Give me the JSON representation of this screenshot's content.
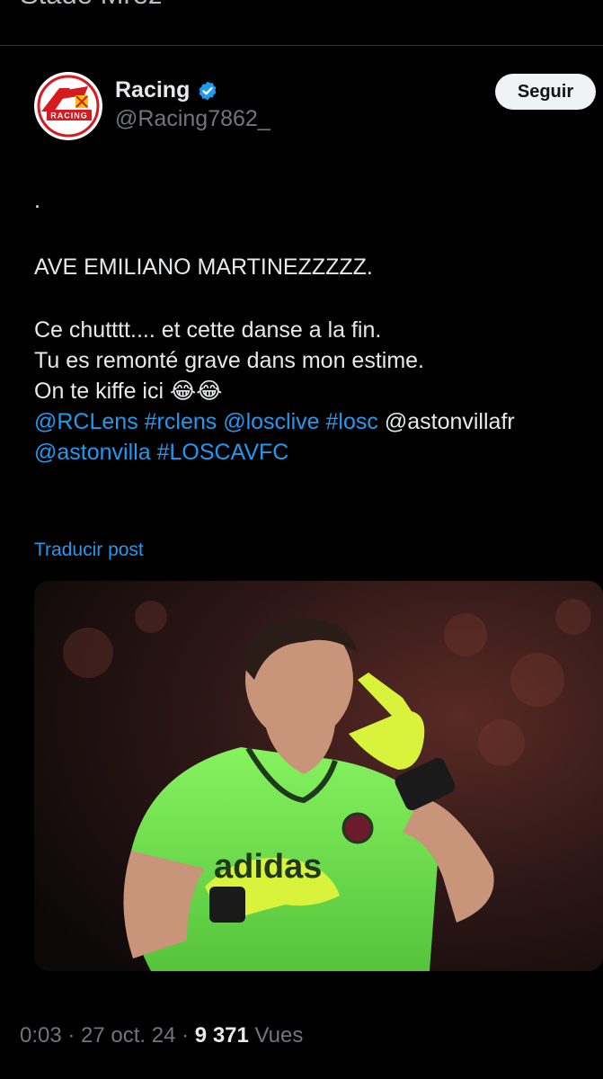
{
  "previous_post": {
    "text": "Stade Mrez"
  },
  "author": {
    "display_name": "Racing",
    "handle": "@Racing7862_",
    "avatar_icon": "racing-club-lens-logo",
    "verified_icon": "verified-badge-icon",
    "verified_color": "#1d9bf0"
  },
  "follow_button": {
    "label": "Seguir"
  },
  "tweet": {
    "line_dot": ".",
    "line_headline": "AVE EMILIANO MARTINEZZZZZ.",
    "line_1": "Ce chutttt.... et cette danse a la fin.",
    "line_2": "Tu es remonté grave dans mon estime.",
    "line_3": "On te kiffe ici",
    "emoji": "😂😂",
    "links": {
      "rclens_mention": "@RCLens",
      "rclens_tag": "#rclens",
      "losclive_mention": "@losclive",
      "losc_tag": "#losc",
      "astonvillafr": "@astonvillafr",
      "astonvilla": "@astonvilla",
      "loscavfc_tag": "#LOSCAVFC"
    }
  },
  "translate": {
    "label": "Traducir post"
  },
  "media": {
    "kit_sponsor": "adidas",
    "description_icon": "goalkeeper-photo"
  },
  "footer": {
    "time": "0:03",
    "sep1": " · ",
    "date": "27 oct. 24",
    "sep2": " · ",
    "views_count": "9 371",
    "views_label": "Vues"
  },
  "colors": {
    "background": "#000000",
    "text": "#e7e9ea",
    "muted": "#71767b",
    "link": "#1d9bf0",
    "kit_green": "#7ef05a"
  }
}
